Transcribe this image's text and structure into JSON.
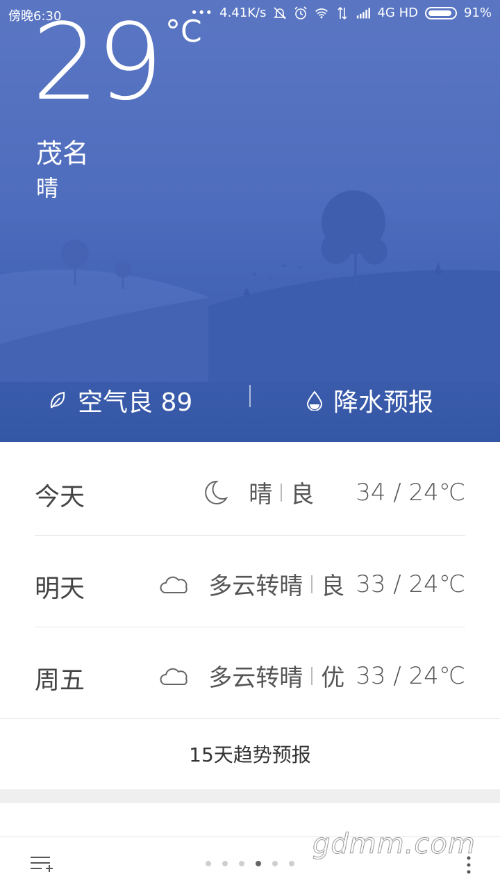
{
  "status_bar": {
    "time": "傍晚6:30",
    "net_speed": "4.41K/s",
    "network": "4G HD",
    "battery_percent": "91%",
    "battery_level": 0.91
  },
  "current": {
    "temperature": "29",
    "unit": "°C",
    "city": "茂名",
    "condition": "晴"
  },
  "hero_actions": {
    "air_quality": "空气良 89",
    "rain_forecast": "降水预报"
  },
  "forecast": [
    {
      "day": "今天",
      "icon": "moon-icon",
      "weather": "晴",
      "aqi": "良",
      "temps": "34 / 24℃"
    },
    {
      "day": "明天",
      "icon": "cloud-icon",
      "weather": "多云转晴",
      "aqi": "良",
      "temps": "33 / 24℃"
    },
    {
      "day": "周五",
      "icon": "cloud-icon",
      "weather": "多云转晴",
      "aqi": "优",
      "temps": "33 / 24℃"
    }
  ],
  "trend_label": "15天趋势预报",
  "pager": {
    "count": 6,
    "active": 4
  },
  "watermark": "gdmm.com",
  "colors": {
    "hero_top": "#5a76c3",
    "hero_bottom": "#3457a5"
  }
}
